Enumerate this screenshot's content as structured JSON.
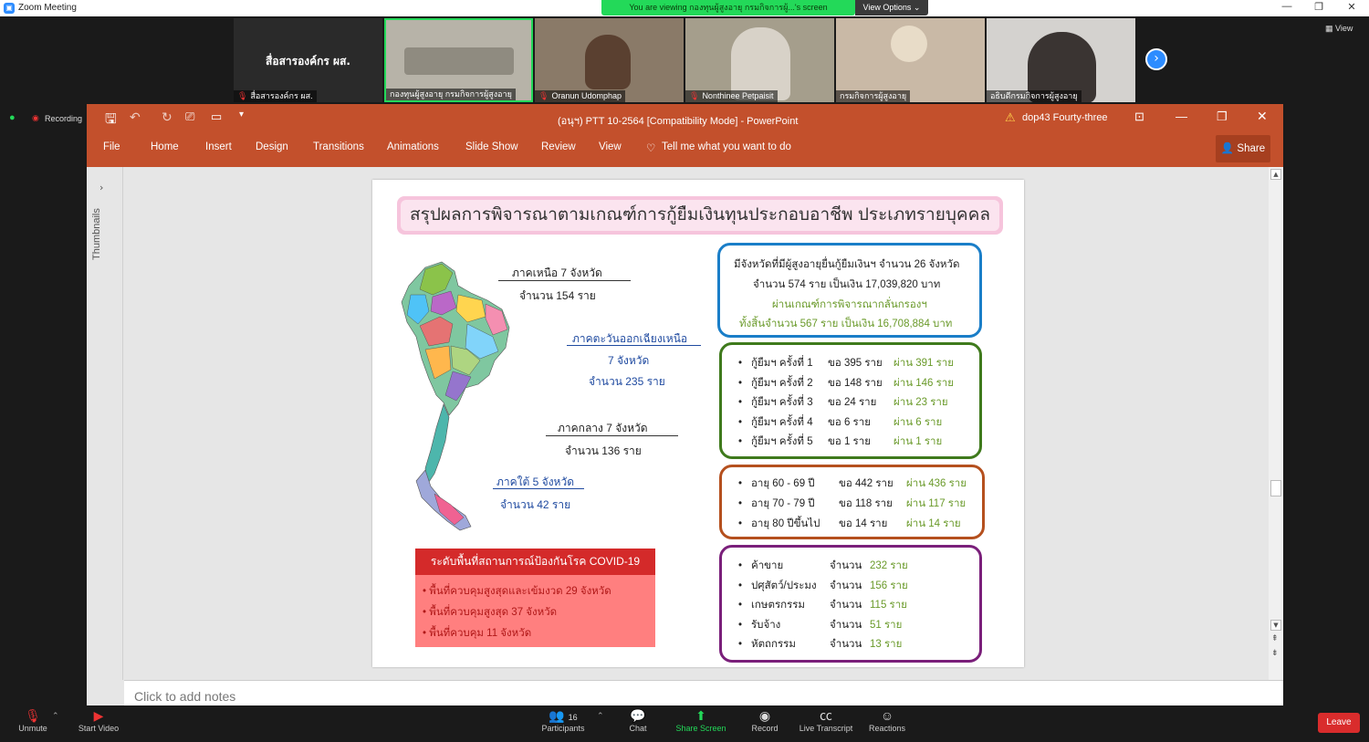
{
  "zoom": {
    "window_title": "Zoom Meeting",
    "viewing_banner": "You are viewing กองทุนผู้สูงอายุ กรมกิจการผู้...'s screen",
    "view_options": "View Options",
    "view_toggle": "View",
    "recording": "Recording",
    "participants": [
      {
        "name": "สื่อสารองค์กร ผส.",
        "big_label": "สื่อสารองค์กร ผส.",
        "muted": true,
        "tone": "#2a2a2a"
      },
      {
        "name": "กองทุนผู้สูงอายุ กรมกิจการผู้สูงอายุ",
        "muted": false,
        "tone": "#b7b3a8"
      },
      {
        "name": "Oranun Udomphap",
        "muted": true,
        "tone": "#8a7a68"
      },
      {
        "name": "Nonthinee Petpaisit",
        "muted": true,
        "tone": "#a59e8c"
      },
      {
        "name": "กรมกิจการผู้สูงอายุ",
        "muted": false,
        "tone": "#c9b9a6"
      },
      {
        "name": "อธิบดีกรมกิจการผู้สูงอายุ",
        "muted": false,
        "tone": "#d4d2cf"
      }
    ]
  },
  "ppt": {
    "title": "(อนุฯ) PTT 10-2564 [Compatibility Mode]  -  PowerPoint",
    "user": "dop43 Fourty-three",
    "tabs": [
      "File",
      "Home",
      "Insert",
      "Design",
      "Transitions",
      "Animations",
      "Slide Show",
      "Review",
      "View"
    ],
    "tell_me": "Tell me what you want to do",
    "share": "Share",
    "thumbnails": "Thumbnails",
    "notes_placeholder": "Click to add notes"
  },
  "slide": {
    "title": "สรุปผลการพิจารณาตามเกณฑ์การกู้ยืมเงินทุนประกอบอาชีพ ประเภทรายบุคคล",
    "regions": {
      "north": {
        "line1": "ภาคเหนือ 7 จังหวัด",
        "line2": "จำนวน 154 ราย"
      },
      "northeast": {
        "line1": "ภาคตะวันออกเฉียงเหนือ",
        "line2": "7 จังหวัด",
        "line3": "จำนวน 235 ราย"
      },
      "central": {
        "line1": "ภาคกลาง 7 จังหวัด",
        "line2": "จำนวน 136 ราย"
      },
      "south": {
        "line1": "ภาคใต้ 5 จังหวัด",
        "line2": "จำนวน 42 ราย"
      }
    },
    "covid": {
      "title": "ระดับพื้นที่สถานการณ์ป้องกันโรค COVID-19",
      "items": [
        "พื้นที่ควบคุมสูงสุดและเข้มงวด 29 จังหวัด",
        "พื้นที่ควบคุมสูงสุด 37 จังหวัด",
        "พื้นที่ควบคุม 11 จังหวัด"
      ]
    },
    "summary": {
      "line1": "มีจังหวัดที่มีผู้สูงอายุยื่นกู้ยืมเงินฯ จำนวน 26 จังหวัด",
      "line2": "จำนวน 574 ราย เป็นเงิน 17,039,820 บาท",
      "line3": "ผ่านเกณฑ์การพิจารณากลั่นกรองฯ",
      "line4": "ทั้งสิ้นจำนวน 567 ราย เป็นเงิน 16,708,884 บาท"
    },
    "loans": [
      {
        "label": "กู้ยืมฯ ครั้งที่ 1",
        "ask": "ขอ 395 ราย",
        "pass": "ผ่าน 391 ราย"
      },
      {
        "label": "กู้ยืมฯ ครั้งที่ 2",
        "ask": "ขอ 148 ราย",
        "pass": "ผ่าน 146 ราย"
      },
      {
        "label": "กู้ยืมฯ ครั้งที่ 3",
        "ask": "ขอ   24 ราย",
        "pass": "ผ่าน  23 ราย"
      },
      {
        "label": "กู้ยืมฯ ครั้งที่ 4",
        "ask": "ขอ     6 ราย",
        "pass": "ผ่าน   6 ราย"
      },
      {
        "label": "กู้ยืมฯ ครั้งที่ 5",
        "ask": "ขอ     1 ราย",
        "pass": "ผ่าน   1 ราย"
      }
    ],
    "ages": [
      {
        "label": "อายุ 60 - 69 ปี",
        "ask": "ขอ  442 ราย",
        "pass": "ผ่าน 436 ราย"
      },
      {
        "label": "อายุ 70 - 79 ปี",
        "ask": "ขอ  118 ราย",
        "pass": "ผ่าน 117 ราย"
      },
      {
        "label": "อายุ 80 ปีขึ้นไป",
        "ask": "ขอ    14 ราย",
        "pass": "ผ่าน  14 ราย"
      }
    ],
    "jobs": [
      {
        "label": "ค้าขาย",
        "count_label": "จำนวน",
        "count": "232 ราย"
      },
      {
        "label": "ปศุสัตว์/ประมง",
        "count_label": "จำนวน",
        "count": "156 ราย"
      },
      {
        "label": "เกษตรกรรม",
        "count_label": "จำนวน",
        "count": "115 ราย"
      },
      {
        "label": "รับจ้าง",
        "count_label": "จำนวน",
        "count": "51 ราย"
      },
      {
        "label": "หัตถกรรม",
        "count_label": "จำนวน",
        "count": "13 ราย"
      }
    ]
  },
  "toolbar": {
    "unmute": "Unmute",
    "start_video": "Start Video",
    "participants": "Participants",
    "participants_count": "16",
    "chat": "Chat",
    "share_screen": "Share Screen",
    "record": "Record",
    "live_transcript": "Live Transcript",
    "reactions": "Reactions",
    "leave": "Leave"
  }
}
